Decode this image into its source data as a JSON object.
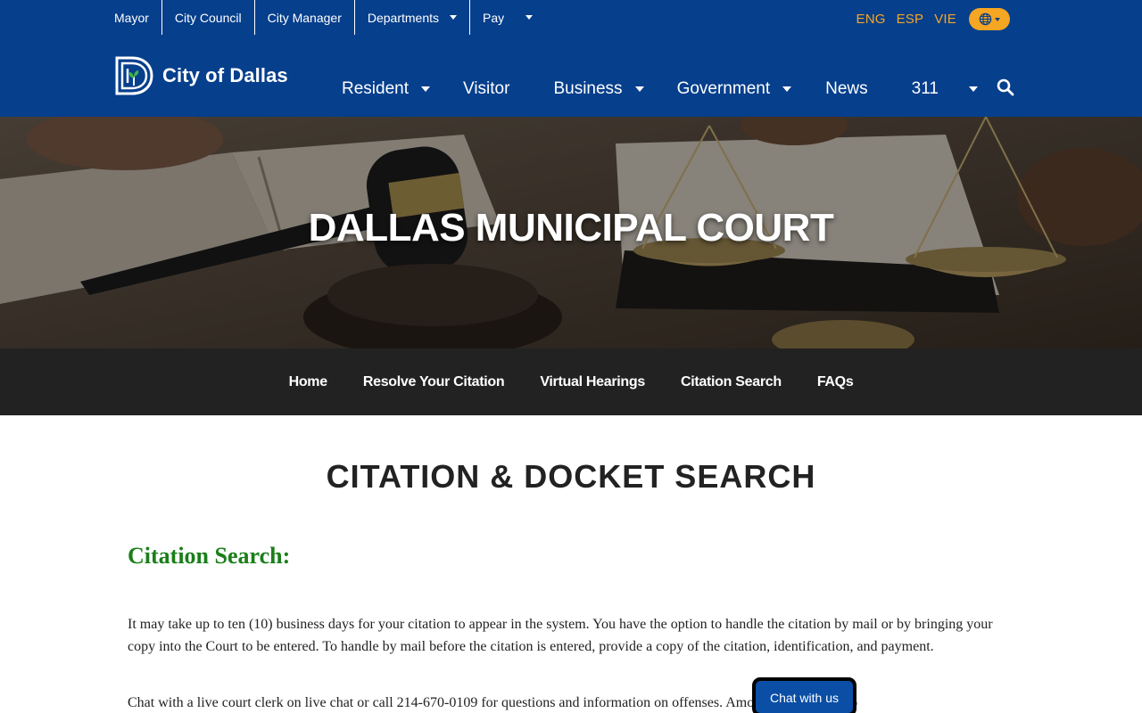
{
  "utility_nav": {
    "items": [
      {
        "label": "Mayor"
      },
      {
        "label": "City Council"
      },
      {
        "label": "City Manager"
      },
      {
        "label": "Departments"
      },
      {
        "label": "Pay"
      }
    ]
  },
  "languages": [
    "ENG",
    "ESP",
    "VIE"
  ],
  "logo": {
    "text": "City of Dallas"
  },
  "main_nav": {
    "items": [
      {
        "label": "Resident"
      },
      {
        "label": "Visitor"
      },
      {
        "label": "Business"
      },
      {
        "label": "Government"
      },
      {
        "label": "News"
      },
      {
        "label": "311"
      }
    ]
  },
  "hero": {
    "title": "DALLAS MUNICIPAL COURT"
  },
  "sub_nav": {
    "items": [
      {
        "label": "Home"
      },
      {
        "label": "Resolve Your Citation"
      },
      {
        "label": "Virtual Hearings"
      },
      {
        "label": "Citation Search"
      },
      {
        "label": "FAQs"
      }
    ]
  },
  "content": {
    "page_heading": "CITATION & DOCKET SEARCH",
    "section_title": "Citation Search:",
    "paragraph_1": "It may take up to ten (10) business days for your citation to appear in the system. You have the option to handle the citation by mail or by bringing your copy into the Court to be entered. To handle by mail before the citation is entered, provide a copy of the citation, identification, and payment.",
    "paragraph_2": "Chat with a live court clerk on live chat or call 214-670-0109 for questions and information on offenses. Amounts are subject to"
  },
  "chat": {
    "label": "Chat with us"
  },
  "colors": {
    "header_blue": "#063f8c",
    "accent_orange": "#f5a623",
    "subnav_bg": "#222222",
    "section_green": "#1a7f1a",
    "chat_blue": "#0a4ea5"
  },
  "icons": [
    "dallas-logo-icon",
    "globe-icon",
    "chevron-down-icon",
    "search-icon"
  ]
}
